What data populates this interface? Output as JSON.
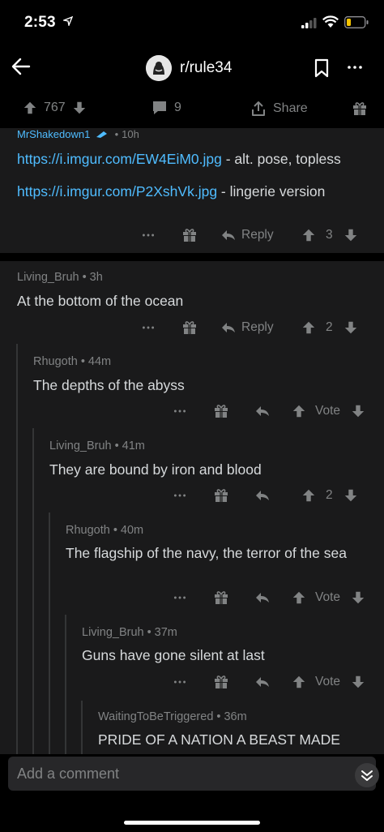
{
  "status_bar": {
    "time": "2:53"
  },
  "header": {
    "subreddit": "r/rule34"
  },
  "post_bar": {
    "votes": "767",
    "comments": "9",
    "share_label": "Share"
  },
  "comments": [
    {
      "author": "MrShakedown1",
      "age": "10h",
      "paragraphs": [
        {
          "link": "https://i.imgur.com/EW4EiM0.jpg",
          "text": " - alt. pose, topless"
        },
        {
          "link": "https://i.imgur.com/P2XshVk.jpg",
          "text": " - lingerie version"
        }
      ],
      "reply_label": "Reply",
      "score": "3"
    },
    {
      "author": "Living_Bruh",
      "age": "3h",
      "body": "At the bottom of the ocean",
      "reply_label": "Reply",
      "score": "2"
    },
    {
      "author": "Rhugoth",
      "age": "44m",
      "body": "The depths of the abyss",
      "score": "Vote"
    },
    {
      "author": "Living_Bruh",
      "age": "41m",
      "body": "They are bound by iron and blood",
      "score": "2"
    },
    {
      "author": "Rhugoth",
      "age": "40m",
      "body": "The flagship of the navy, the terror of the sea",
      "score": "Vote"
    },
    {
      "author": "Living_Bruh",
      "age": "37m",
      "body": "Guns have gone silent at last",
      "score": "Vote"
    },
    {
      "author": "WaitingToBeTriggered",
      "age": "36m",
      "body": "PRIDE OF A NATION A BEAST MADE"
    }
  ],
  "comment_input": {
    "placeholder": "Add a comment"
  },
  "icons": {
    "upvote": "arrow-up-icon",
    "downvote": "arrow-down-icon",
    "comment": "speech-bubble-icon",
    "share": "share-icon",
    "award": "gift-icon",
    "reply": "reply-arrow-icon",
    "more": "ellipsis-icon"
  },
  "colors": {
    "link": "#4fbcff",
    "muted": "#818384",
    "text": "#d7dadc",
    "panel": "#1a1a1b"
  }
}
